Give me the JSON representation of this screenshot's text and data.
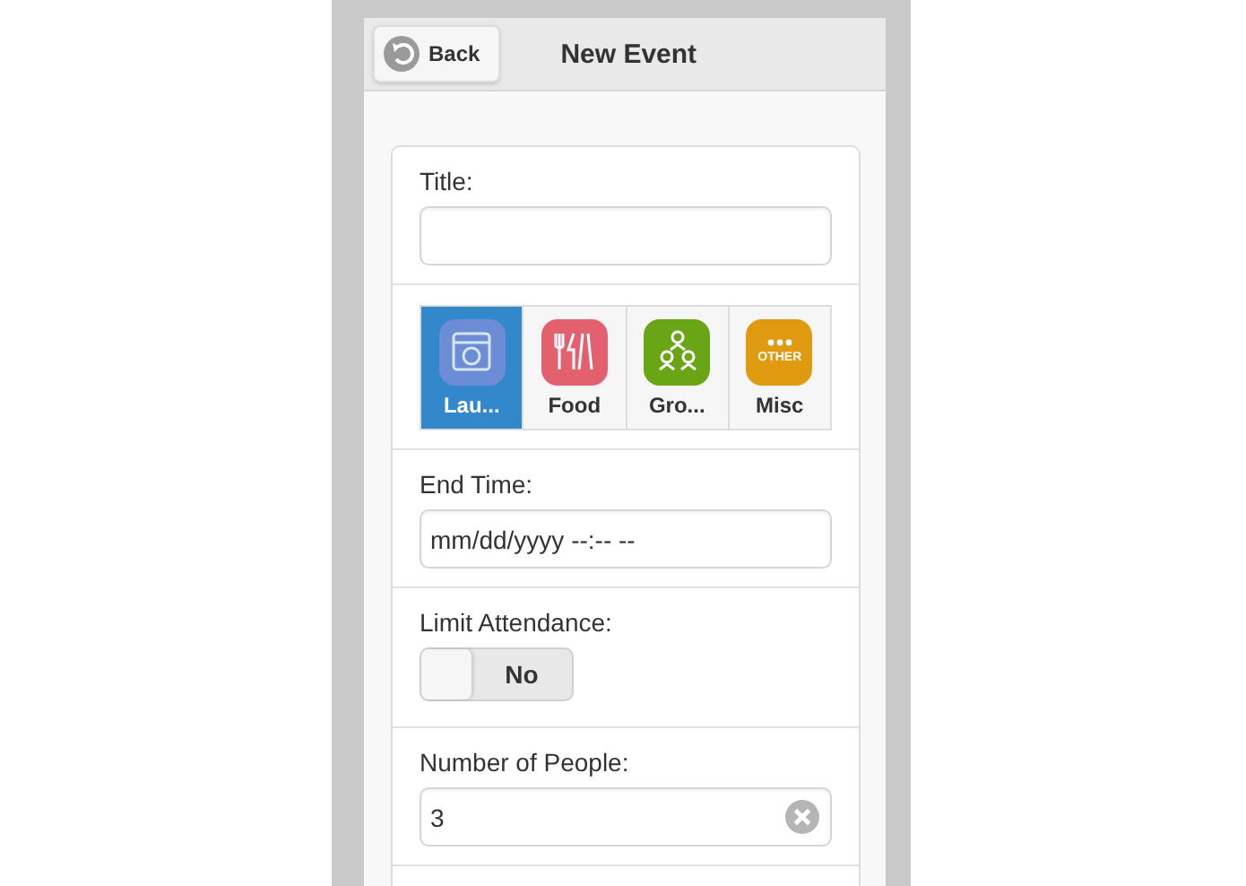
{
  "header": {
    "back_label": "Back",
    "title": "New Event"
  },
  "title_field": {
    "label": "Title:"
  },
  "categories": [
    {
      "kind": "laundry",
      "label": "Lau...",
      "selected": true,
      "color": "#7b8fd8"
    },
    {
      "kind": "food",
      "label": "Food",
      "selected": false,
      "color": "#e3606f"
    },
    {
      "kind": "group",
      "label": "Gro...",
      "selected": false,
      "color": "#6aa516"
    },
    {
      "kind": "other",
      "label": "Misc",
      "selected": false,
      "color": "#e09a10",
      "icon_text": "OTHER"
    }
  ],
  "end_time": {
    "label": "End Time:",
    "value": "mm/dd/yyyy --:-- --"
  },
  "limit_attendance": {
    "label": "Limit Attendance:",
    "on": false,
    "state_label": "No"
  },
  "people": {
    "label": "Number of People:",
    "value": "3"
  }
}
